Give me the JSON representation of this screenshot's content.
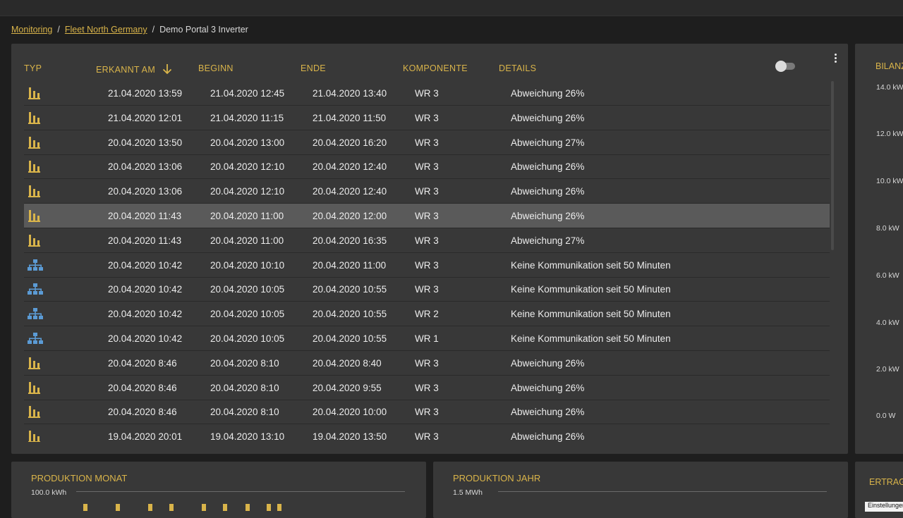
{
  "breadcrumb": {
    "items": [
      "Monitoring",
      "Fleet North Germany"
    ],
    "current": "Demo Portal 3 Inverter",
    "separator": "/"
  },
  "table": {
    "headers": {
      "typ": "TYP",
      "erkannt": "ERKANNT AM",
      "beginn": "BEGINN",
      "ende": "ENDE",
      "komponente": "KOMPONENTE",
      "details": "DETAILS"
    },
    "rows": [
      {
        "type": "deviation",
        "erkannt": "21.04.2020 13:59",
        "beginn": "21.04.2020 12:45",
        "ende": "21.04.2020 13:40",
        "komponente": "WR 3",
        "details": "Abweichung 26%"
      },
      {
        "type": "deviation",
        "erkannt": "21.04.2020 12:01",
        "beginn": "21.04.2020 11:15",
        "ende": "21.04.2020 11:50",
        "komponente": "WR 3",
        "details": "Abweichung 26%"
      },
      {
        "type": "deviation",
        "erkannt": "20.04.2020 13:50",
        "beginn": "20.04.2020 13:00",
        "ende": "20.04.2020 16:20",
        "komponente": "WR 3",
        "details": "Abweichung 27%"
      },
      {
        "type": "deviation",
        "erkannt": "20.04.2020 13:06",
        "beginn": "20.04.2020 12:10",
        "ende": "20.04.2020 12:40",
        "komponente": "WR 3",
        "details": "Abweichung 26%"
      },
      {
        "type": "deviation",
        "erkannt": "20.04.2020 13:06",
        "beginn": "20.04.2020 12:10",
        "ende": "20.04.2020 12:40",
        "komponente": "WR 3",
        "details": "Abweichung 26%"
      },
      {
        "type": "deviation",
        "erkannt": "20.04.2020 11:43",
        "beginn": "20.04.2020 11:00",
        "ende": "20.04.2020 12:00",
        "komponente": "WR 3",
        "details": "Abweichung 26%",
        "selected": true
      },
      {
        "type": "deviation",
        "erkannt": "20.04.2020 11:43",
        "beginn": "20.04.2020 11:00",
        "ende": "20.04.2020 16:35",
        "komponente": "WR 3",
        "details": "Abweichung 27%"
      },
      {
        "type": "network",
        "erkannt": "20.04.2020 10:42",
        "beginn": "20.04.2020 10:10",
        "ende": "20.04.2020 11:00",
        "komponente": "WR 3",
        "details": "Keine Kommunikation seit 50 Minuten"
      },
      {
        "type": "network",
        "erkannt": "20.04.2020 10:42",
        "beginn": "20.04.2020 10:05",
        "ende": "20.04.2020 10:55",
        "komponente": "WR 3",
        "details": "Keine Kommunikation seit 50 Minuten"
      },
      {
        "type": "network",
        "erkannt": "20.04.2020 10:42",
        "beginn": "20.04.2020 10:05",
        "ende": "20.04.2020 10:55",
        "komponente": "WR 2",
        "details": "Keine Kommunikation seit 50 Minuten"
      },
      {
        "type": "network",
        "erkannt": "20.04.2020 10:42",
        "beginn": "20.04.2020 10:05",
        "ende": "20.04.2020 10:55",
        "komponente": "WR 1",
        "details": "Keine Kommunikation seit 50 Minuten"
      },
      {
        "type": "deviation",
        "erkannt": "20.04.2020 8:46",
        "beginn": "20.04.2020 8:10",
        "ende": "20.04.2020 8:40",
        "komponente": "WR 3",
        "details": "Abweichung 26%"
      },
      {
        "type": "deviation",
        "erkannt": "20.04.2020 8:46",
        "beginn": "20.04.2020 8:10",
        "ende": "20.04.2020 9:55",
        "komponente": "WR 3",
        "details": "Abweichung 26%"
      },
      {
        "type": "deviation",
        "erkannt": "20.04.2020 8:46",
        "beginn": "20.04.2020 8:10",
        "ende": "20.04.2020 10:00",
        "komponente": "WR 3",
        "details": "Abweichung 26%"
      },
      {
        "type": "deviation",
        "erkannt": "19.04.2020 20:01",
        "beginn": "19.04.2020 13:10",
        "ende": "19.04.2020 13:50",
        "komponente": "WR 3",
        "details": "Abweichung 26%"
      }
    ]
  },
  "side_panel": {
    "title": "BILANZ",
    "ticks": [
      "14.0 kW",
      "12.0 kW",
      "10.0 kW",
      "8.0 kW",
      "6.0 kW",
      "4.0 kW",
      "2.0 kW",
      "0.0 W"
    ]
  },
  "bottom": {
    "produktion_monat": {
      "title": "PRODUKTION MONAT",
      "max": "100.0 kWh"
    },
    "produktion_jahr": {
      "title": "PRODUKTION JAHR",
      "max": "1.5 MWh"
    },
    "ertrag": {
      "title": "ERTRAG"
    },
    "corner_button": "Einstellungen"
  },
  "colors": {
    "accent": "#d9b44a",
    "network_icon": "#5b9bd5",
    "panel": "#383838",
    "background": "#1e1e1e"
  }
}
